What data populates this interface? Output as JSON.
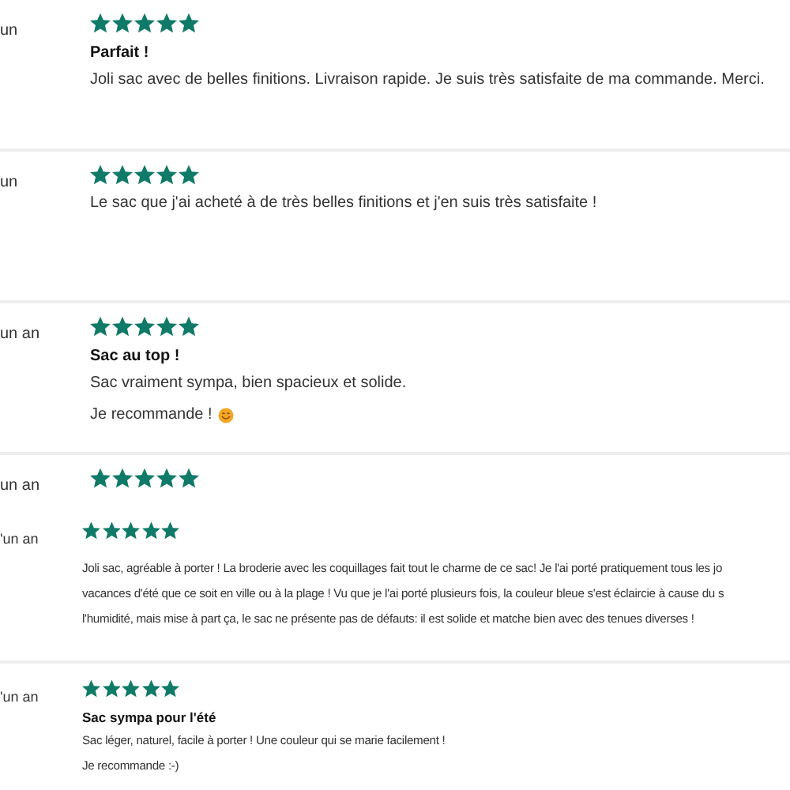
{
  "reviews": [
    {
      "date": "un",
      "stars": 5,
      "title": "Parfait !",
      "lines": [
        "Joli sac avec de belles finitions. Livraison rapide. Je suis très satisfaite de ma commande. Merci."
      ],
      "compact": false,
      "emoji": false
    },
    {
      "date": "un",
      "stars": 5,
      "lines": [
        "Le sac que j'ai acheté à de très belles finitions et j'en suis très satisfaite !"
      ],
      "compact": false,
      "emoji": false
    },
    {
      "date": "un an",
      "stars": 5,
      "title": "Sac au top !",
      "lines": [
        "Sac vraiment sympa, bien spacieux et solide.",
        "Je recommande !"
      ],
      "compact": false,
      "emoji": true
    },
    {
      "date": "un an",
      "stars": 5,
      "compact": false
    },
    {
      "date": "'un an",
      "stars": 5,
      "lines": [
        "Joli sac, agréable à porter ! La broderie avec les coquillages fait tout le charme de ce sac! Je l'ai porté pratiquement tous les jo",
        "vacances d'été que ce soit en ville ou à la plage ! Vu que je l'ai porté plusieurs fois, la couleur bleue s'est éclaircie à cause du s",
        "l'humidité, mais mise à part ça, le sac ne présente pas de défauts: il est solide et matche bien avec des tenues diverses !"
      ],
      "compact": true,
      "emoji": false
    },
    {
      "date": "'un an",
      "stars": 5,
      "title": "Sac sympa pour l'été",
      "lines": [
        "Sac léger, naturel, facile à porter ! Une couleur qui se marie facilement !",
        "Je recommande :-)"
      ],
      "compact": true,
      "emoji": false
    }
  ]
}
